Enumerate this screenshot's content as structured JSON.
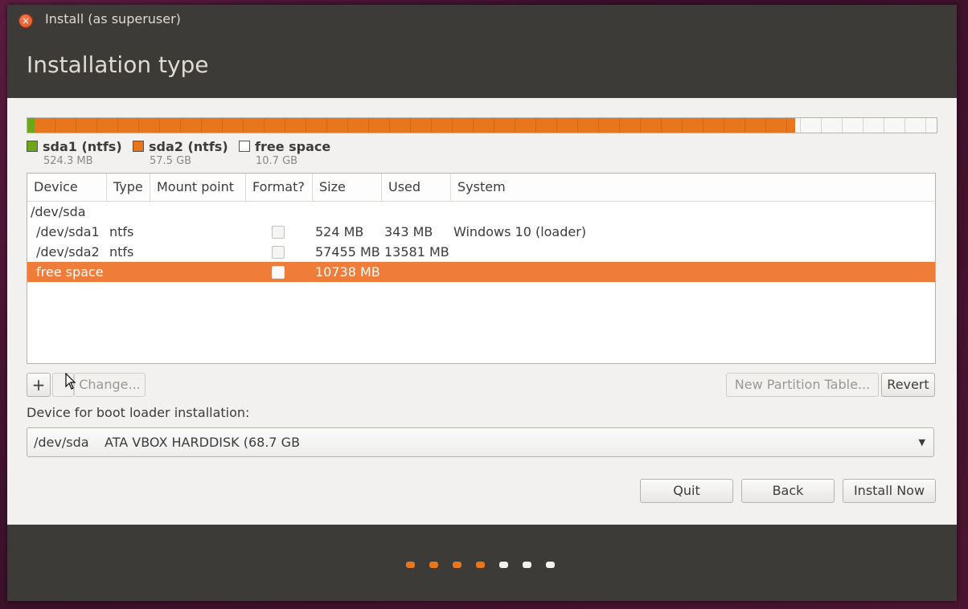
{
  "window": {
    "title": "Install (as superuser)",
    "close_glyph": "×",
    "page_title": "Installation type"
  },
  "disk_usage": {
    "partitions": [
      {
        "name": "sda1 (ntfs)",
        "size": "524.3 MB",
        "color": "#6ea61a",
        "fraction": 0.0076
      },
      {
        "name": "sda2 (ntfs)",
        "size": "57.5 GB",
        "color": "#e8761c",
        "fraction": 0.8367
      },
      {
        "name": "free space",
        "size": "10.7 GB",
        "color": "#ffffff",
        "fraction": 0.1557
      }
    ]
  },
  "table": {
    "columns": [
      "Device",
      "Type",
      "Mount point",
      "Format?",
      "Size",
      "Used",
      "System"
    ],
    "rows": [
      {
        "device": "/dev/sda",
        "type": "",
        "mount": "",
        "format": null,
        "size": "",
        "used": "",
        "system": "",
        "selected": false
      },
      {
        "device": "/dev/sda1",
        "type": "ntfs",
        "mount": "",
        "format": false,
        "size": "524 MB",
        "used": "343 MB",
        "system": "Windows 10 (loader)",
        "selected": false
      },
      {
        "device": "/dev/sda2",
        "type": "ntfs",
        "mount": "",
        "format": false,
        "size": "57455 MB",
        "used": "13581 MB",
        "system": "",
        "selected": false
      },
      {
        "device": "free space",
        "type": "",
        "mount": "",
        "format": false,
        "size": "10738 MB",
        "used": "",
        "system": "",
        "selected": true
      }
    ]
  },
  "toolbar": {
    "add_label": "+",
    "remove_label": "",
    "change_label": "Change...",
    "new_table_label": "New Partition Table...",
    "revert_label": "Revert"
  },
  "bootloader": {
    "label": "Device for boot loader installation:",
    "device": "/dev/sda",
    "model": "ATA VBOX HARDDISK (68.7 GB"
  },
  "actions": {
    "quit": "Quit",
    "back": "Back",
    "install_now": "Install Now"
  },
  "progress": {
    "total_steps": 7,
    "completed_steps": 4,
    "done_color": "#e8761c",
    "todo_color": "#f2f1f0"
  }
}
